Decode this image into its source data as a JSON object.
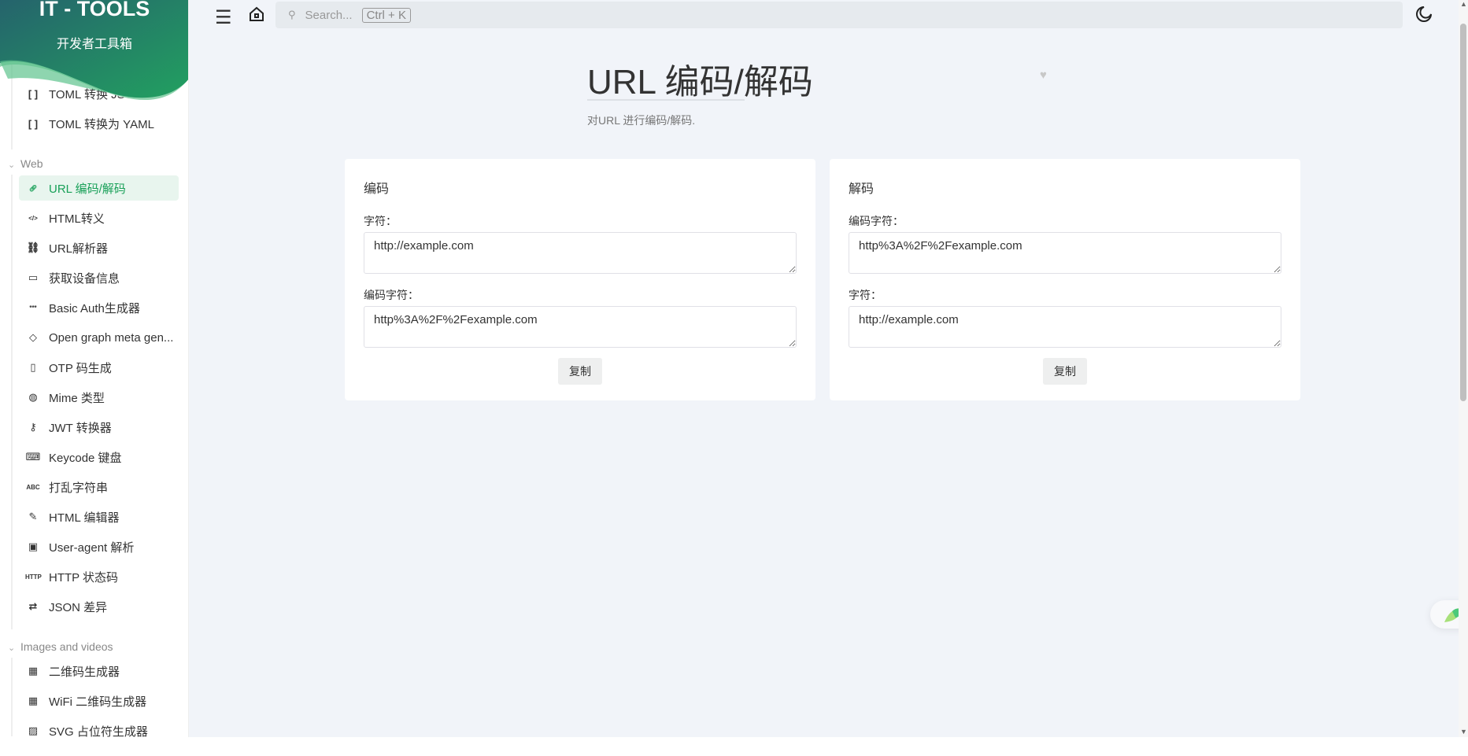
{
  "app": {
    "title": "IT - TOOLS",
    "subtitle": "开发者工具箱",
    "accent": "#18a058"
  },
  "topbar": {
    "search_placeholder": "Search...",
    "search_shortcut": "Ctrl + K"
  },
  "sidebar": {
    "partial_items": [
      {
        "label": "TOML 转换 JSON",
        "icon": "brackets-icon"
      },
      {
        "label": "TOML 转换为 YAML",
        "icon": "brackets-icon"
      }
    ],
    "groups": [
      {
        "label": "Web",
        "items": [
          {
            "label": "URL 编码/解码",
            "icon": "link-icon",
            "active": true
          },
          {
            "label": "HTML转义",
            "icon": "code-icon"
          },
          {
            "label": "URL解析器",
            "icon": "unlink-icon"
          },
          {
            "label": "获取设备信息",
            "icon": "monitor-icon"
          },
          {
            "label": "Basic Auth生成器",
            "icon": "password-icon"
          },
          {
            "label": "Open graph meta gen...",
            "icon": "tags-icon"
          },
          {
            "label": "OTP 码生成",
            "icon": "phone-icon"
          },
          {
            "label": "Mime 类型",
            "icon": "globe-icon"
          },
          {
            "label": "JWT 转换器",
            "icon": "key-icon"
          },
          {
            "label": "Keycode 键盘",
            "icon": "keyboard-icon"
          },
          {
            "label": "打乱字符串",
            "icon": "abc-icon"
          },
          {
            "label": "HTML 编辑器",
            "icon": "edit-icon"
          },
          {
            "label": "User-agent 解析",
            "icon": "browser-icon"
          },
          {
            "label": "HTTP 状态码",
            "icon": "http-icon"
          },
          {
            "label": "JSON 差异",
            "icon": "diff-icon"
          }
        ]
      },
      {
        "label": "Images and videos",
        "items": [
          {
            "label": "二维码生成器",
            "icon": "qrcode-icon"
          },
          {
            "label": "WiFi 二维码生成器",
            "icon": "qrcode-icon"
          },
          {
            "label": "SVG 占位符生成器",
            "icon": "image-icon"
          }
        ]
      }
    ]
  },
  "page": {
    "title": "URL 编码/解码",
    "description": "对URL 进行编码/解码."
  },
  "encode": {
    "title": "编码",
    "input_label": "字符：",
    "input_value": "http://example.com",
    "output_label": "编码字符：",
    "output_value": "http%3A%2F%2Fexample.com",
    "copy_label": "复制"
  },
  "decode": {
    "title": "解码",
    "input_label": "编码字符：",
    "input_value": "http%3A%2F%2Fexample.com",
    "output_label": "字符：",
    "output_value": "http://example.com",
    "copy_label": "复制"
  }
}
